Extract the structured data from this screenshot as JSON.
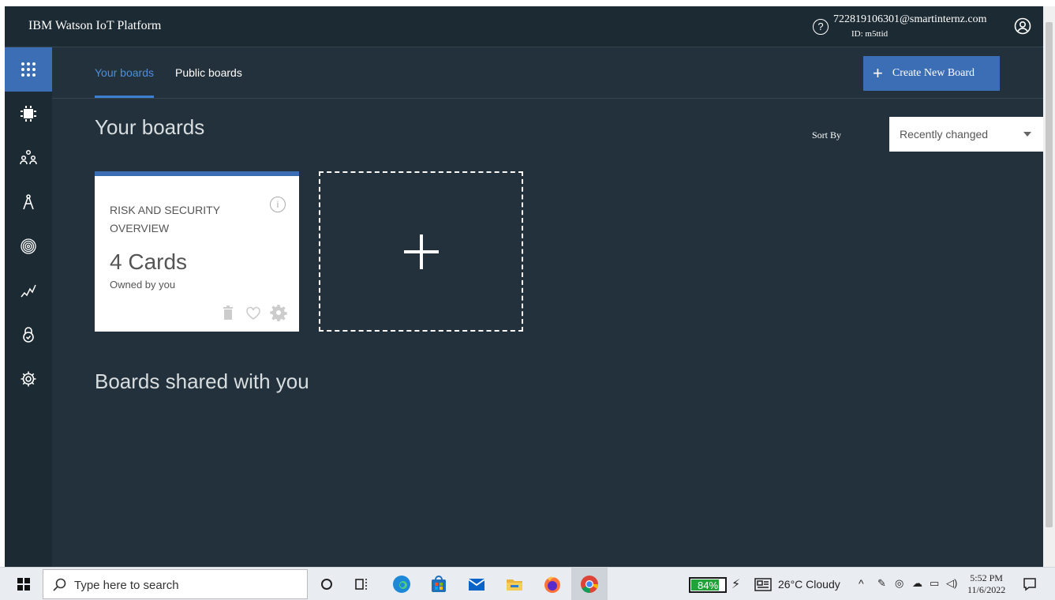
{
  "header": {
    "brand": "IBM Watson IoT Platform",
    "help_icon": "?",
    "user_email": "722819106301@smartinternz.com",
    "user_id": "ID: m5ttid"
  },
  "sidenav": {
    "icons": [
      "apps-grid-icon",
      "chip-icon",
      "members-icon",
      "rules-compass-icon",
      "fingerprint-icon",
      "usage-chart-icon",
      "security-lock-icon",
      "settings-gear-icon"
    ],
    "active_index": 0
  },
  "tabs": [
    {
      "label": "Your boards",
      "active": true
    },
    {
      "label": "Public boards",
      "active": false
    }
  ],
  "create_button": {
    "label": "Create New Board"
  },
  "main": {
    "title": "Your boards",
    "sort_label": "Sort By",
    "sort_value": "Recently changed",
    "shared_title": "Boards shared with you"
  },
  "boards": [
    {
      "title": "RISK AND SECURITY OVERVIEW",
      "count": "4 Cards",
      "owner": "Owned by you",
      "info_icon": "i"
    }
  ],
  "taskbar": {
    "search_placeholder": "Type here to search",
    "battery_text": "84%",
    "battery_level": 0.84,
    "weather": "26°C  Cloudy",
    "time": "5:52 PM",
    "date": "11/6/2022"
  },
  "colors": {
    "background": "#22313b",
    "topbar": "#1c2a33",
    "accent": "#3b6eb5",
    "tab_active_text": "#4d8fd9",
    "battery": "#22a33a"
  }
}
